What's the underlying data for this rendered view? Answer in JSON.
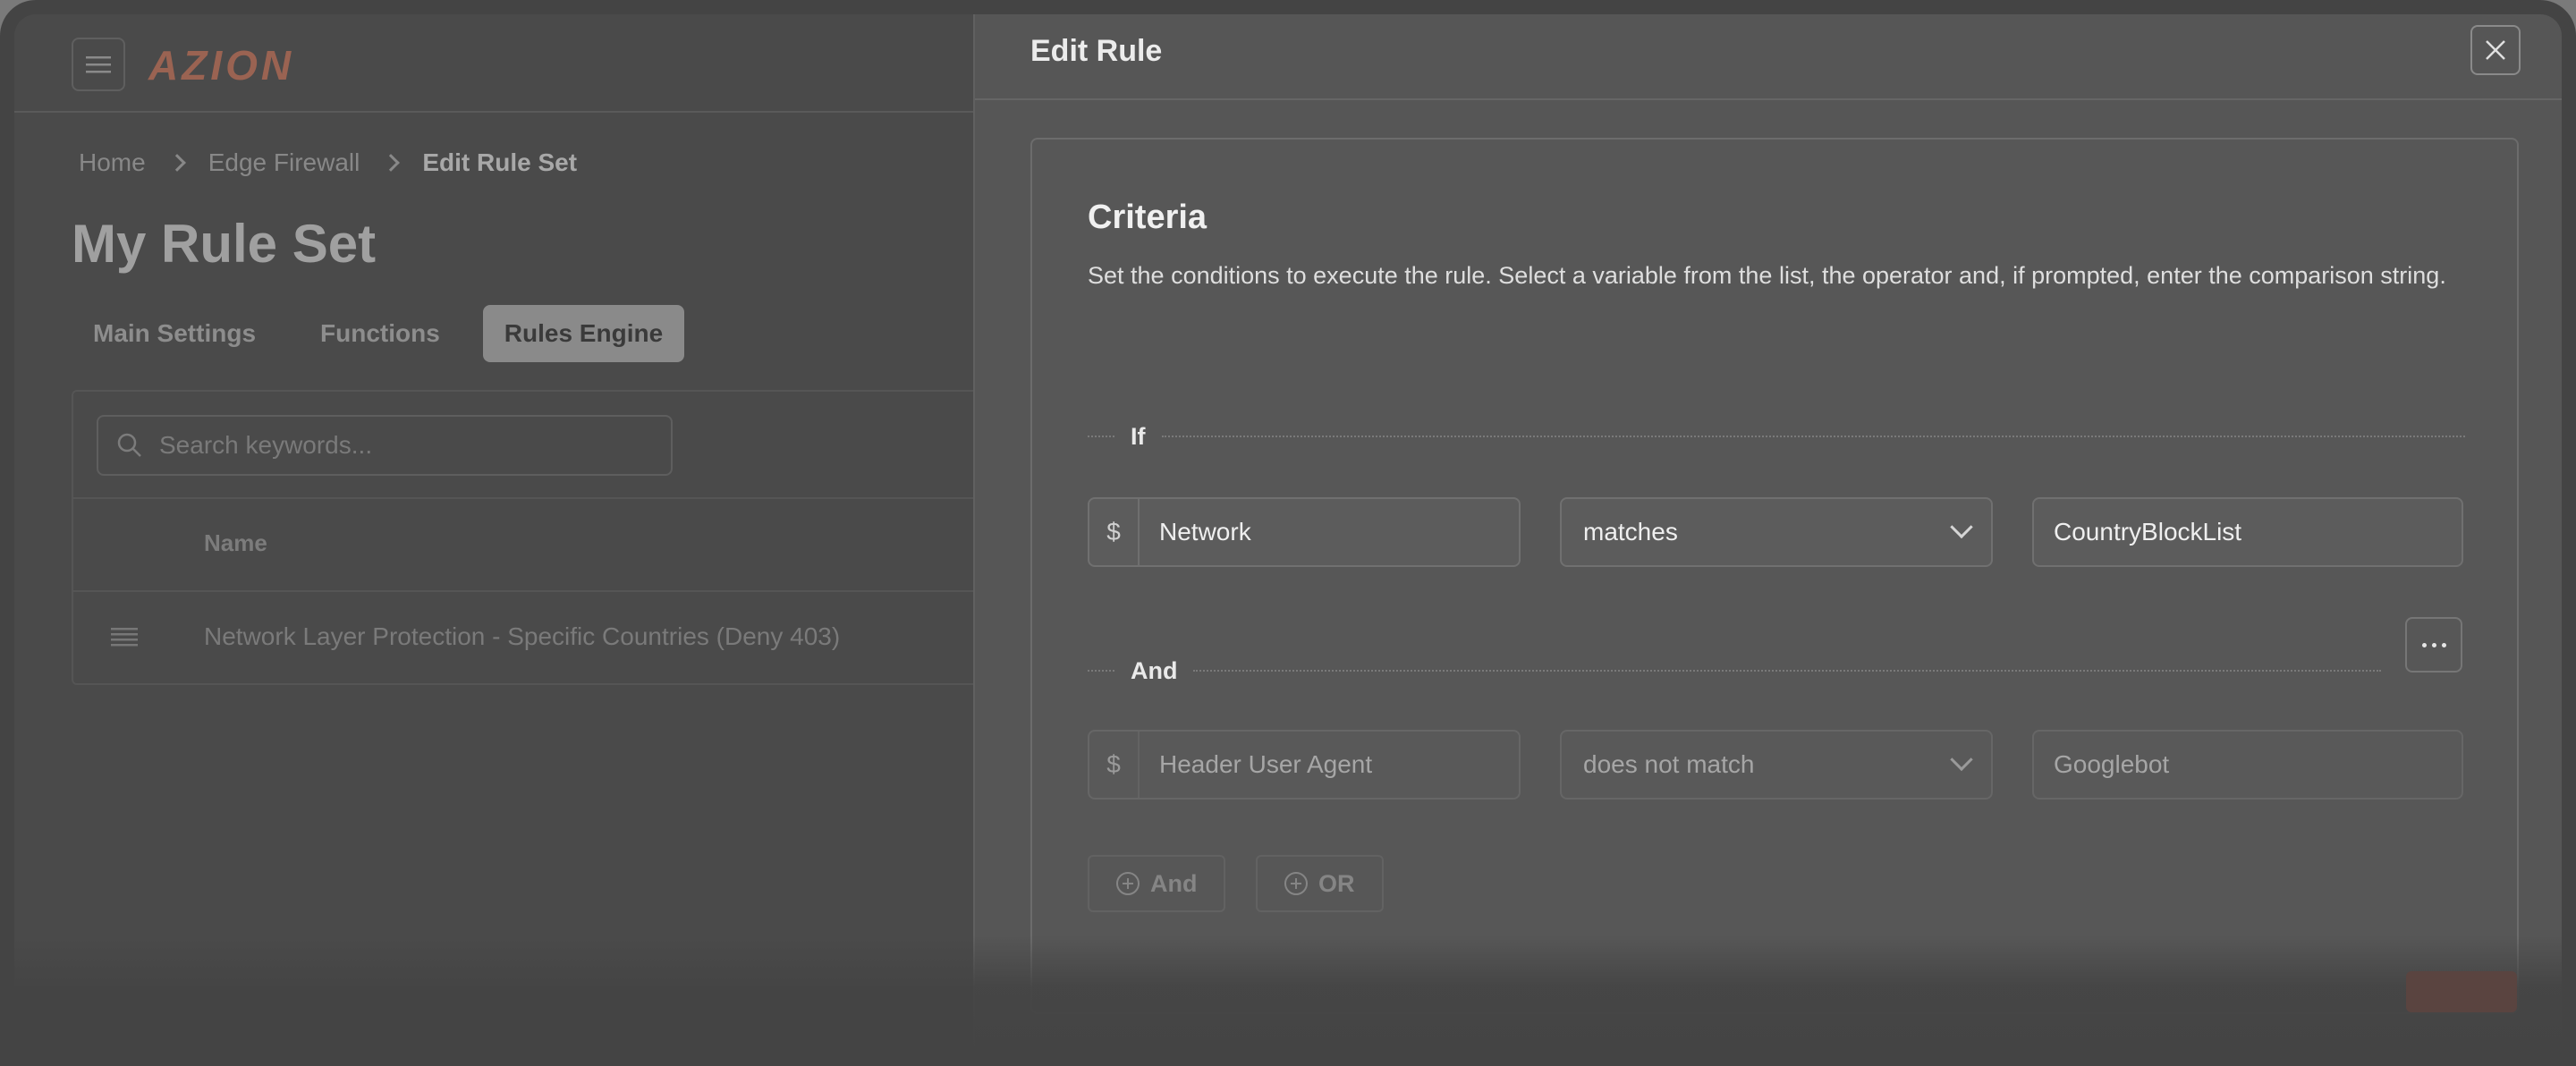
{
  "app": {
    "logo_text": "AZION",
    "accent_color": "#9a6352"
  },
  "breadcrumb": {
    "items": [
      "Home",
      "Edge Firewall",
      "Edit Rule Set"
    ]
  },
  "page": {
    "title": "My Rule Set"
  },
  "tabs": [
    {
      "label": "Main Settings",
      "active": false
    },
    {
      "label": "Functions",
      "active": false
    },
    {
      "label": "Rules Engine",
      "active": true
    }
  ],
  "search": {
    "placeholder": "Search keywords..."
  },
  "table": {
    "columns": [
      "Name"
    ],
    "rows": [
      {
        "name": "Network Layer Protection - Specific Countries (Deny 403)"
      }
    ]
  },
  "drawer": {
    "title": "Edit Rule",
    "criteria": {
      "title": "Criteria",
      "description": "Set the conditions to execute the rule. Select a variable from the list, the operator and, if prompted, enter the comparison string.",
      "if_label": "If",
      "and_label": "And",
      "conditions": [
        {
          "prefix": "$",
          "variable": "Network",
          "operator": "matches",
          "value": "CountryBlockList"
        },
        {
          "prefix": "$",
          "variable": "Header User Agent",
          "operator": "does not match",
          "value": "Googlebot"
        }
      ],
      "add_and_label": "And",
      "add_or_label": "OR"
    }
  },
  "icons": {
    "menu": "hamburger-icon",
    "close": "close-icon",
    "search": "search-icon",
    "more": "more-horizontal-icon",
    "drag": "drag-handle-icon",
    "add": "plus-circle-icon",
    "dropdown": "chevron-down-icon"
  }
}
